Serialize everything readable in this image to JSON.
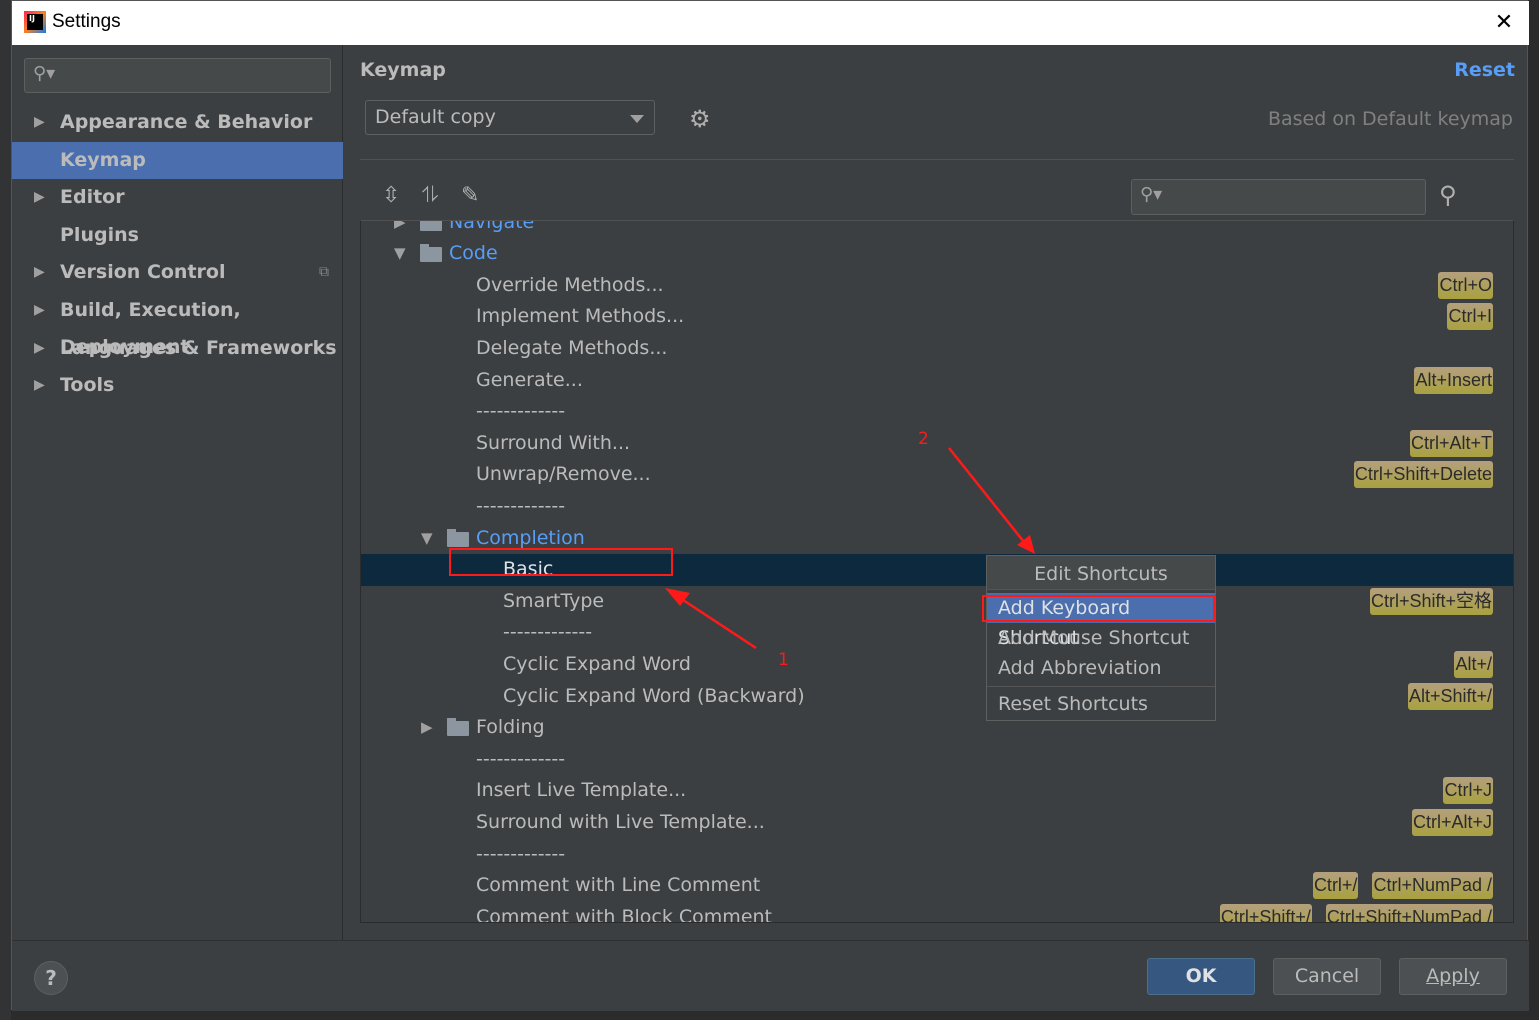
{
  "window": {
    "title": "Settings"
  },
  "sidebar": {
    "items": [
      {
        "label": "Appearance & Behavior",
        "expandable": true
      },
      {
        "label": "Keymap",
        "expandable": false,
        "selected": true
      },
      {
        "label": "Editor",
        "expandable": true
      },
      {
        "label": "Plugins",
        "expandable": false
      },
      {
        "label": "Version Control",
        "expandable": true
      },
      {
        "label": "Build, Execution, Deployment",
        "expandable": true
      },
      {
        "label": "Languages & Frameworks",
        "expandable": true
      },
      {
        "label": "Tools",
        "expandable": true
      }
    ]
  },
  "main": {
    "title": "Keymap",
    "reset_label": "Reset",
    "keymap_value": "Default copy",
    "based_on": "Based on Default keymap"
  },
  "tree": {
    "rows": [
      {
        "label": "Navigate",
        "level": 1,
        "folder": true,
        "expanded": false,
        "keys": []
      },
      {
        "label": "Code",
        "level": 1,
        "folder": true,
        "expanded": true,
        "keys": []
      },
      {
        "label": "Override Methods...",
        "level": 2,
        "keys": [
          "Ctrl+O"
        ]
      },
      {
        "label": "Implement Methods...",
        "level": 2,
        "keys": [
          "Ctrl+I"
        ]
      },
      {
        "label": "Delegate Methods...",
        "level": 2,
        "keys": []
      },
      {
        "label": "Generate...",
        "level": 2,
        "keys": [
          "Alt+Insert"
        ]
      },
      {
        "label": "-------------",
        "level": 2,
        "keys": []
      },
      {
        "label": "Surround With...",
        "level": 2,
        "keys": [
          "Ctrl+Alt+T"
        ]
      },
      {
        "label": "Unwrap/Remove...",
        "level": 2,
        "keys": [
          "Ctrl+Shift+Delete"
        ]
      },
      {
        "label": "-------------",
        "level": 2,
        "keys": []
      },
      {
        "label": "Completion",
        "level": 2,
        "folder": true,
        "expanded": true,
        "keys": []
      },
      {
        "label": "Basic",
        "level": 3,
        "selected": true,
        "keys": []
      },
      {
        "label": "SmartType",
        "level": 3,
        "keys": [
          "Ctrl+Shift+空格"
        ]
      },
      {
        "label": "-------------",
        "level": 3,
        "keys": []
      },
      {
        "label": "Cyclic Expand Word",
        "level": 3,
        "keys": [
          "Alt+/"
        ]
      },
      {
        "label": "Cyclic Expand Word (Backward)",
        "level": 3,
        "keys": [
          "Alt+Shift+/"
        ]
      },
      {
        "label": "Folding",
        "level": 2,
        "folder": true,
        "expanded": false,
        "plain": true,
        "keys": []
      },
      {
        "label": "-------------",
        "level": 2,
        "keys": []
      },
      {
        "label": "Insert Live Template...",
        "level": 2,
        "keys": [
          "Ctrl+J"
        ]
      },
      {
        "label": "Surround with Live Template...",
        "level": 2,
        "keys": [
          "Ctrl+Alt+J"
        ]
      },
      {
        "label": "-------------",
        "level": 2,
        "keys": []
      },
      {
        "label": "Comment with Line Comment",
        "level": 2,
        "keys": [
          "Ctrl+/",
          "Ctrl+NumPad /"
        ]
      },
      {
        "label": "Comment with Block Comment",
        "level": 2,
        "keys": [
          "Ctrl+Shift+/",
          "Ctrl+Shift+NumPad /"
        ]
      }
    ]
  },
  "popup": {
    "header": "Edit Shortcuts",
    "items": [
      "Add Keyboard Shortcut",
      "Add Mouse Shortcut",
      "Add Abbreviation",
      "Reset Shortcuts"
    ],
    "selected": "Add Keyboard Shortcut"
  },
  "footer": {
    "help": "?",
    "ok": "OK",
    "cancel": "Cancel",
    "apply": "Apply"
  },
  "annotations": {
    "label1": "1",
    "label2": "2",
    "color": "#ff1a1a"
  },
  "colors": {
    "accent": "#4b6eaf",
    "link": "#589df6",
    "selection": "#0d293e",
    "badge": "#a9a13f"
  }
}
